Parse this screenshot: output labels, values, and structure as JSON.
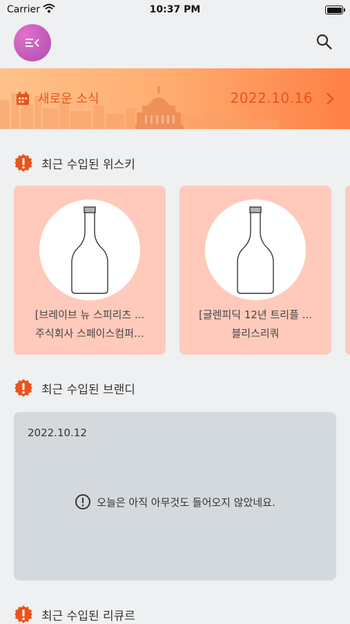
{
  "status_bar": {
    "carrier": "Carrier",
    "time": "10:37 PM"
  },
  "news": {
    "title": "새로운 소식",
    "date": "2022.10.16"
  },
  "colors": {
    "accent": "#e8541c",
    "card_bg": "#ffcabb",
    "menu": "#c45bbd",
    "empty_bg": "#d3d9dc"
  },
  "sections": {
    "whisky": {
      "title": "최근 수입된 위스키",
      "cards": [
        {
          "name": "[브레이브 뉴 스피리츠 ...",
          "importer": "주식회사 스페이스컴퍼…"
        },
        {
          "name": "[글렌피딕 12년 트리플 ...",
          "importer": "블리스리쿼"
        }
      ]
    },
    "brandy": {
      "title": "최근 수입된 브랜디",
      "date": "2022.10.12",
      "empty_message": "오늘은 아직 아무것도 들어오지 않았네요."
    },
    "liqueur": {
      "title": "최근 수입된 리큐르"
    }
  },
  "icons": {
    "menu": "menu-collapse-icon",
    "search": "search-icon",
    "calendar": "calendar-icon",
    "chevron": "chevron-right-icon",
    "warning": "warning-badge-icon",
    "info": "info-circle-icon",
    "bottle": "bottle-icon"
  }
}
